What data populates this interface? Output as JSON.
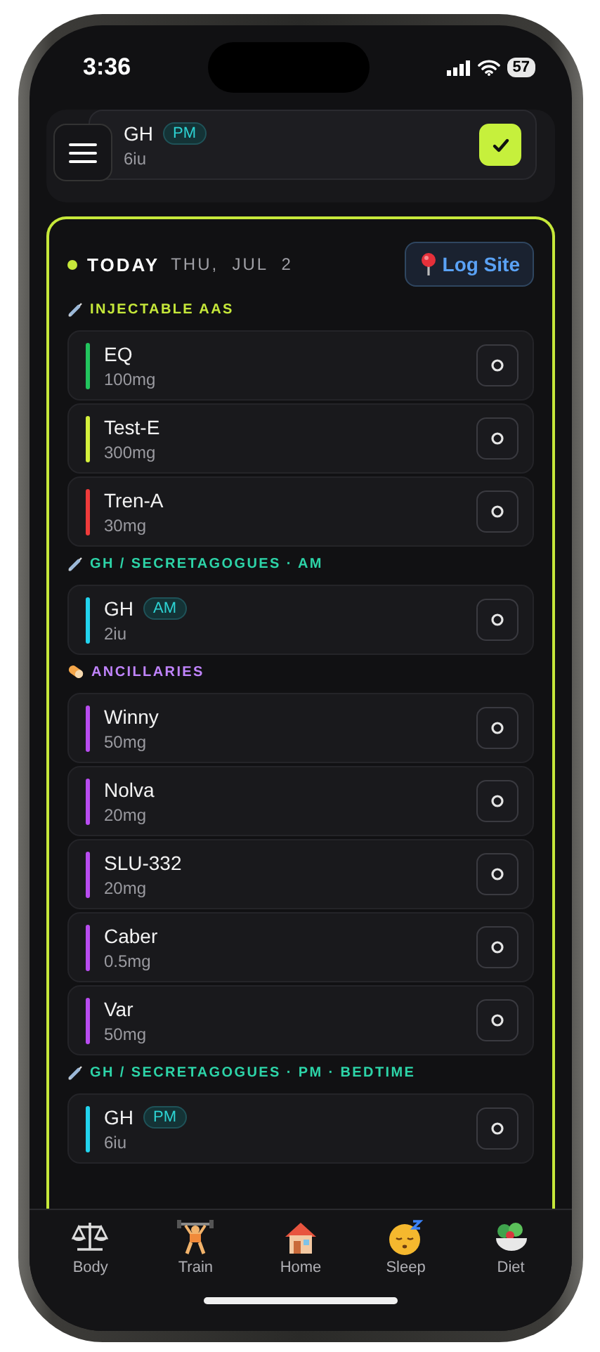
{
  "status_bar": {
    "time": "3:36",
    "battery": "57"
  },
  "next_dose": {
    "name": "GH",
    "tag": "PM",
    "dose": "6iu",
    "checked": true
  },
  "today": {
    "label": "TODAY",
    "date": "THU,  JUL  2",
    "action": "Log Site"
  },
  "sections": [
    {
      "title": "INJECTABLE AAS",
      "kind": "injection",
      "color": "#c6e83a",
      "items": [
        {
          "name": "EQ",
          "dose": "100mg",
          "color": "#22c55e",
          "checked": false
        },
        {
          "name": "Test-E",
          "dose": "300mg",
          "color": "#d4f03c",
          "checked": false
        },
        {
          "name": "Tren-A",
          "dose": "30mg",
          "color": "#ef3b3b",
          "checked": false
        }
      ]
    },
    {
      "title": "GH / SECRETAGOGUES · AM",
      "kind": "injection",
      "color": "#2dd4a8",
      "items": [
        {
          "name": "GH",
          "tag": "AM",
          "dose": "2iu",
          "color": "#22d3ee",
          "checked": false
        }
      ]
    },
    {
      "title": "ANCILLARIES",
      "kind": "pill",
      "color": "#c084fc",
      "items": [
        {
          "name": "Winny",
          "dose": "50mg",
          "color": "#b84cf0",
          "checked": false
        },
        {
          "name": "Nolva",
          "dose": "20mg",
          "color": "#b84cf0",
          "checked": false
        },
        {
          "name": "SLU-332",
          "dose": "20mg",
          "color": "#b84cf0",
          "checked": false
        },
        {
          "name": "Caber",
          "dose": "0.5mg",
          "color": "#b84cf0",
          "checked": false
        },
        {
          "name": "Var",
          "dose": "50mg",
          "color": "#b84cf0",
          "checked": false
        }
      ]
    },
    {
      "title": "GH / SECRETAGOGUES · PM · BEDTIME",
      "kind": "injection",
      "color": "#2dd4a8",
      "items": [
        {
          "name": "GH",
          "tag": "PM",
          "dose": "6iu",
          "color": "#22d3ee",
          "checked": false
        }
      ]
    }
  ],
  "tabs": [
    {
      "label": "Body",
      "kind": "scale"
    },
    {
      "label": "Train",
      "kind": "lift"
    },
    {
      "label": "Home",
      "kind": "home"
    },
    {
      "label": "Sleep",
      "kind": "sleep"
    },
    {
      "label": "Diet",
      "kind": "salad"
    }
  ]
}
